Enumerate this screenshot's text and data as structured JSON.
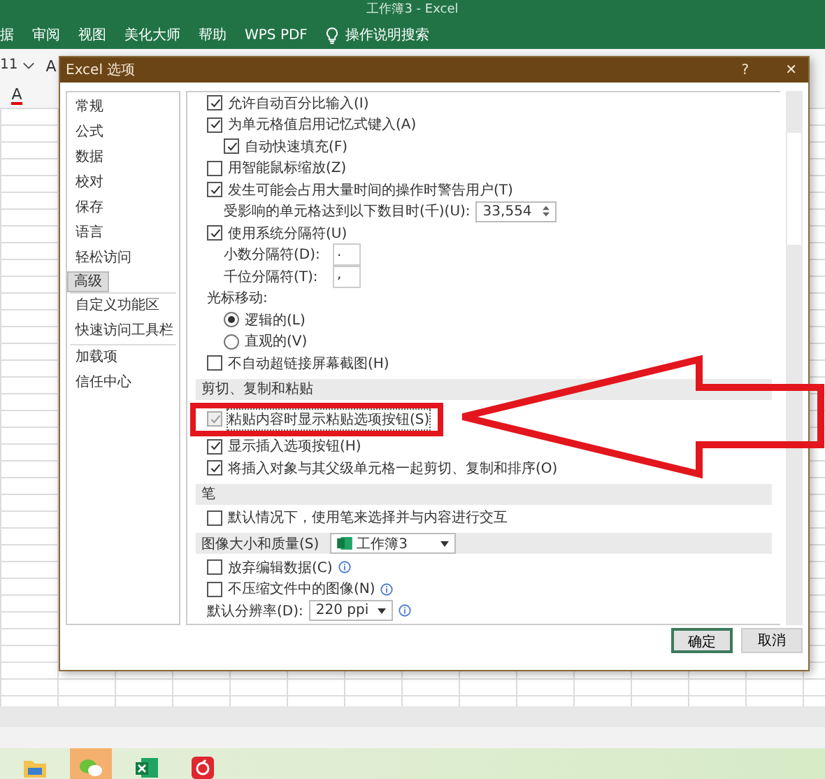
{
  "window": {
    "title": "工作簿3  -  Excel"
  },
  "ribbon_tabs": [
    {
      "label": "据"
    },
    {
      "label": "审阅"
    },
    {
      "label": "视图"
    },
    {
      "label": "美化大师"
    },
    {
      "label": "帮助"
    },
    {
      "label": "WPS PDF"
    }
  ],
  "tell_me": {
    "label": "操作说明搜索"
  },
  "toolbar": {
    "font_size": "11",
    "grow_font": "A",
    "font_color": "A"
  },
  "dialog": {
    "title": "Excel 选项",
    "help": "?",
    "close": "✕",
    "nav": [
      {
        "label": "常规",
        "selected": false
      },
      {
        "label": "公式",
        "selected": false
      },
      {
        "label": "数据",
        "selected": false
      },
      {
        "label": "校对",
        "selected": false
      },
      {
        "label": "保存",
        "selected": false
      },
      {
        "label": "语言",
        "selected": false
      },
      {
        "label": "轻松访问",
        "selected": false
      },
      {
        "label": "高级",
        "selected": true
      },
      {
        "label": "自定义功能区",
        "selected": false
      },
      {
        "label": "快速访问工具栏",
        "selected": false
      },
      {
        "label": "加载项",
        "selected": false
      },
      {
        "label": "信任中心",
        "selected": false
      }
    ],
    "options": [
      {
        "kind": "check",
        "label": "允许自动百分比输入(I)",
        "checked": true
      },
      {
        "kind": "check",
        "label": "为单元格值启用记忆式键入(A)",
        "checked": true,
        "children": [
          {
            "kind": "check",
            "label": "自动快速填充(F)",
            "checked": true
          }
        ]
      },
      {
        "kind": "check",
        "label": "用智能鼠标缩放(Z)",
        "checked": false
      },
      {
        "kind": "check",
        "label": "发生可能会占用大量时间的操作时警告用户(T)",
        "checked": true,
        "children": [
          {
            "kind": "spin",
            "label": "受影响的单元格达到以下数目时(千)(U):",
            "value": "33,554"
          }
        ]
      },
      {
        "kind": "check",
        "label": "使用系统分隔符(U)",
        "checked": true,
        "children": [
          {
            "kind": "field",
            "label": "小数分隔符(D):",
            "value": "."
          },
          {
            "kind": "field",
            "label": "千位分隔符(T):",
            "value": ","
          }
        ]
      },
      {
        "kind": "label",
        "label": "光标移动:",
        "children": [
          {
            "kind": "radio",
            "label": "逻辑的(L)",
            "selected": true
          },
          {
            "kind": "radio",
            "label": "直观的(V)",
            "selected": false
          }
        ]
      },
      {
        "kind": "check",
        "label": "不自动超链接屏幕截图(H)",
        "checked": false
      },
      {
        "kind": "section",
        "label": "剪切、复制和粘贴"
      },
      {
        "kind": "check",
        "label": "粘贴内容时显示粘贴选项按钮(S)",
        "checked": true,
        "disabled": true,
        "highlighted": true
      },
      {
        "kind": "check",
        "label": "显示插入选项按钮(H)",
        "checked": true
      },
      {
        "kind": "check",
        "label": "将插入对象与其父级单元格一起剪切、复制和排序(O)",
        "checked": true
      },
      {
        "kind": "section",
        "label": "笔"
      },
      {
        "kind": "check",
        "label": "默认情况下，使用笔来选择并与内容进行交互",
        "checked": false
      },
      {
        "kind": "section",
        "label": "图像大小和质量(S)",
        "value": "工作簿3"
      },
      {
        "kind": "check",
        "label": "放弃编辑数据(C)",
        "checked": false,
        "info": true
      },
      {
        "kind": "check",
        "label": "不压缩文件中的图像(N)",
        "checked": false,
        "info": true
      },
      {
        "kind": "select",
        "label": "默认分辨率(D):",
        "value": "220 ppi",
        "info": true
      }
    ],
    "buttons": [
      {
        "label": "确定",
        "default": true
      },
      {
        "label": "取消",
        "default": false
      }
    ]
  }
}
